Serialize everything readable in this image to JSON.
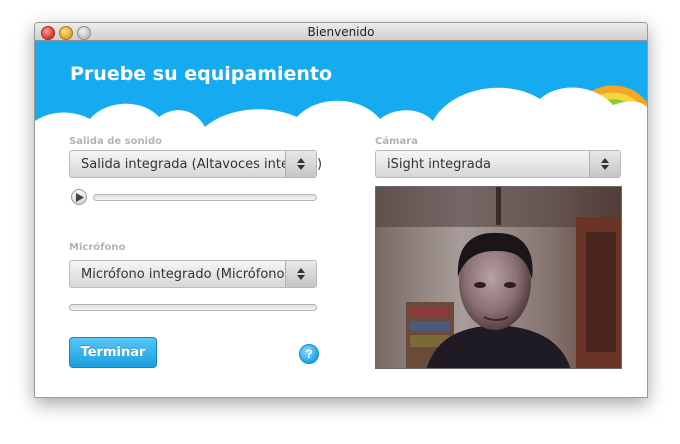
{
  "window": {
    "title": "Bienvenido"
  },
  "header": {
    "title": "Pruebe su equipamiento"
  },
  "sound_output": {
    "label": "Salida de sonido",
    "selected": "Salida integrada (Altavoces internos)"
  },
  "microphone": {
    "label": "Micrófono",
    "selected": "Micrófono integrado (Micrófono in…"
  },
  "camera": {
    "label": "Cámara",
    "selected": "iSight integrada"
  },
  "footer": {
    "finish_label": "Terminar",
    "help_label": "?"
  },
  "colors": {
    "header_blue": "#16aaf0",
    "button_blue": "#1a9fe0"
  },
  "icons": {
    "play": "play-icon",
    "select_arrows": "updown-arrows-icon",
    "rainbow": "rainbow-icon",
    "help": "question-mark-icon"
  }
}
